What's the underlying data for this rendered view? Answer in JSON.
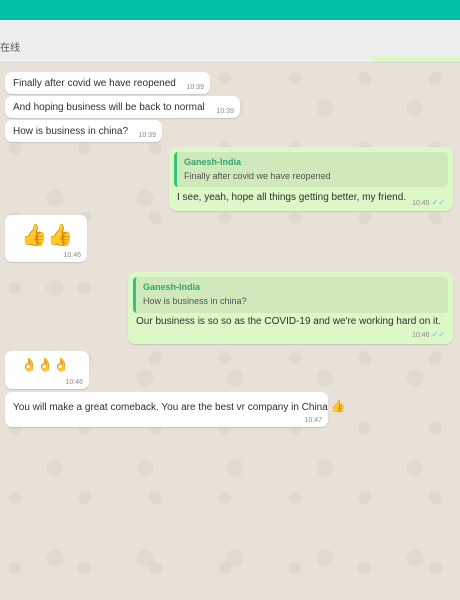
{
  "header": {
    "status": "在线"
  },
  "messages": [
    {
      "text": "Finally after covid we have reopened",
      "time": "10:39"
    },
    {
      "text": "And hoping business will be back to normal",
      "time": "10:39"
    },
    {
      "text": "How is business in china?",
      "time": "10:39"
    },
    {
      "quote_name": "Ganesh-India",
      "quote_text": "Finally after covid we have reopened",
      "text": "I see, yeah, hope all things getting better, my friend.",
      "time": "10:45"
    },
    {
      "emoji": "👍👍",
      "time": "10:46"
    },
    {
      "quote_name": "Ganesh-India",
      "quote_text": "How is business in china?",
      "text": "Our business is so so as the COVID-19 and we're working hard on it.",
      "time": "10:46"
    },
    {
      "emoji": "👌👌👌",
      "time": "10:46"
    },
    {
      "text": "You will make a great comeback. You are the best vr company in China",
      "emoji": "👍",
      "time": "10:47"
    }
  ],
  "icons": {
    "read_receipt": "double-check-icon"
  },
  "colors": {
    "accent": "#00bfa5",
    "outgoing_bubble": "#dcf8c6",
    "incoming_bubble": "#ffffff",
    "read_tick": "#4fc3f7"
  },
  "ticks": "✓✓"
}
